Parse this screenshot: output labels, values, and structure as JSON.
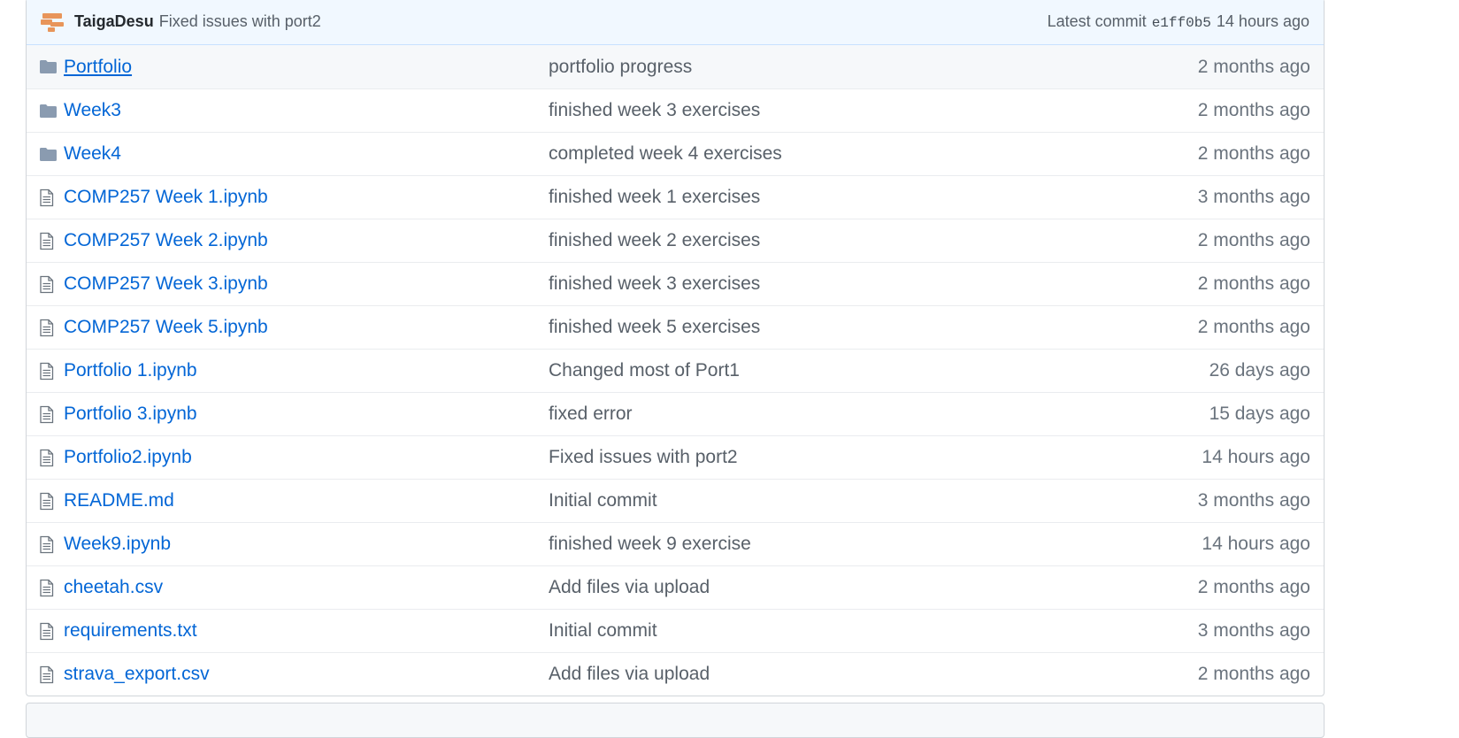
{
  "latest_commit": {
    "author": "TaigaDesu",
    "message": "Fixed issues with port2",
    "label": "Latest commit",
    "sha": "e1ff0b5",
    "age": "14 hours ago"
  },
  "colors": {
    "link": "#0366d6",
    "folder_icon": "#79b8ff",
    "commit_bar_bg": "#f1f8ff",
    "avatar": "#e8955a"
  },
  "files": [
    {
      "type": "folder",
      "icon": "folder-icon",
      "name": "Portfolio",
      "message": "portfolio progress",
      "age": "2 months ago"
    },
    {
      "type": "folder",
      "icon": "folder-icon",
      "name": "Week3",
      "message": "finished week 3 exercises",
      "age": "2 months ago"
    },
    {
      "type": "folder",
      "icon": "folder-icon",
      "name": "Week4",
      "message": "completed week 4 exercises",
      "age": "2 months ago"
    },
    {
      "type": "file",
      "icon": "file-icon",
      "name": "COMP257 Week 1.ipynb",
      "message": "finished week 1 exercises",
      "age": "3 months ago"
    },
    {
      "type": "file",
      "icon": "file-icon",
      "name": "COMP257 Week 2.ipynb",
      "message": "finished week 2 exercises",
      "age": "2 months ago"
    },
    {
      "type": "file",
      "icon": "file-icon",
      "name": "COMP257 Week 3.ipynb",
      "message": "finished week 3 exercises",
      "age": "2 months ago"
    },
    {
      "type": "file",
      "icon": "file-icon",
      "name": "COMP257 Week 5.ipynb",
      "message": "finished week 5 exercises",
      "age": "2 months ago"
    },
    {
      "type": "file",
      "icon": "file-icon",
      "name": "Portfolio 1.ipynb",
      "message": "Changed most of Port1",
      "age": "26 days ago"
    },
    {
      "type": "file",
      "icon": "file-icon",
      "name": "Portfolio 3.ipynb",
      "message": "fixed error",
      "age": "15 days ago"
    },
    {
      "type": "file",
      "icon": "file-icon",
      "name": "Portfolio2.ipynb",
      "message": "Fixed issues with port2",
      "age": "14 hours ago"
    },
    {
      "type": "file",
      "icon": "file-icon",
      "name": "README.md",
      "message": "Initial commit",
      "age": "3 months ago"
    },
    {
      "type": "file",
      "icon": "file-icon",
      "name": "Week9.ipynb",
      "message": "finished week 9 exercise",
      "age": "14 hours ago"
    },
    {
      "type": "file",
      "icon": "file-icon",
      "name": "cheetah.csv",
      "message": "Add files via upload",
      "age": "2 months ago"
    },
    {
      "type": "file",
      "icon": "file-icon",
      "name": "requirements.txt",
      "message": "Initial commit",
      "age": "3 months ago"
    },
    {
      "type": "file",
      "icon": "file-icon",
      "name": "strava_export.csv",
      "message": "Add files via upload",
      "age": "2 months ago"
    }
  ]
}
